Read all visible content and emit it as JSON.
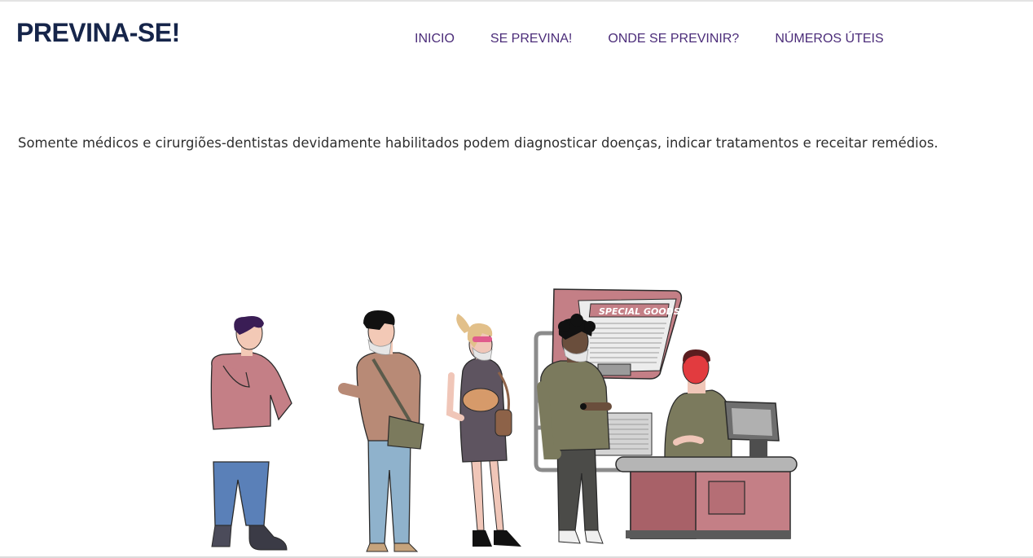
{
  "header": {
    "logo": "PREVINA-SE!",
    "nav": [
      "INICIO",
      "SE PREVINA!",
      "ONDE SE PREVINIR?",
      "NÚMEROS ÚTEIS"
    ]
  },
  "main": {
    "notice": "Somente médicos e cirurgiões-dentistas devidamente habilitados podem diagnosticar doenças, indicar tratamentos e receitar remédios.",
    "illustration": {
      "sign_text": "SPECIAL GOODS"
    }
  },
  "colors": {
    "logo": "#16254a",
    "nav": "#4b2c79",
    "text": "#2e2e2e",
    "accent_pink": "#c47f86"
  }
}
